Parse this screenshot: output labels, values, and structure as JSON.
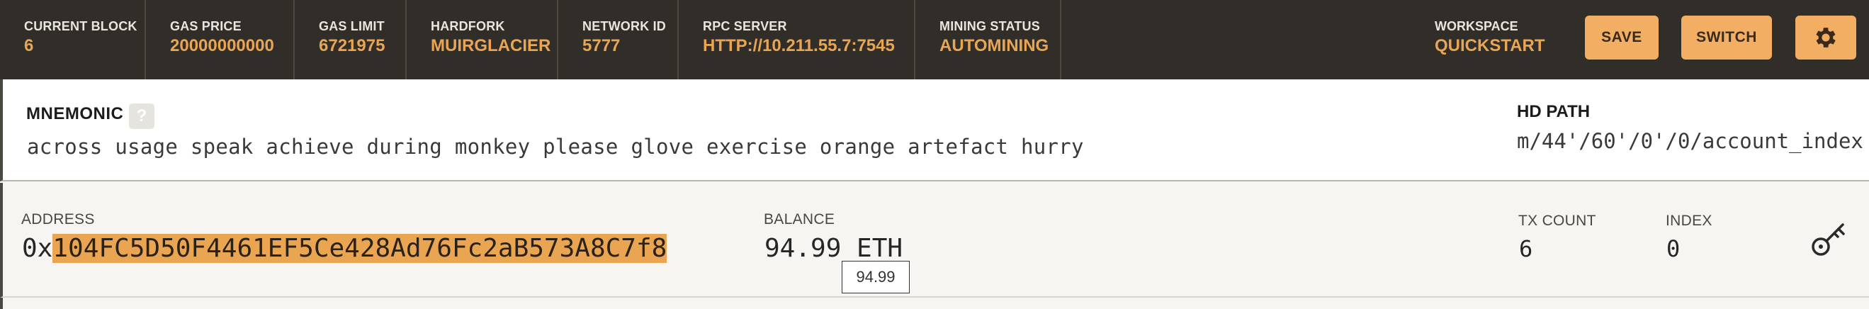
{
  "topbar": {
    "stats": [
      {
        "label": "CURRENT BLOCK",
        "value": "6"
      },
      {
        "label": "GAS PRICE",
        "value": "20000000000"
      },
      {
        "label": "GAS LIMIT",
        "value": "6721975"
      },
      {
        "label": "HARDFORK",
        "value": "MUIRGLACIER"
      },
      {
        "label": "NETWORK ID",
        "value": "5777"
      },
      {
        "label": "RPC SERVER",
        "value": "HTTP://10.211.55.7:7545"
      },
      {
        "label": "MINING STATUS",
        "value": "AUTOMINING"
      }
    ],
    "workspace": {
      "label": "WORKSPACE",
      "value": "QUICKSTART"
    },
    "save_label": "SAVE",
    "switch_label": "SWITCH",
    "settings_icon": "gear-icon"
  },
  "mnemonic": {
    "label": "MNEMONIC",
    "help_glyph": "?",
    "words": "across usage speak achieve during monkey please glove exercise orange artefact hurry",
    "hd_path_label": "HD PATH",
    "hd_path_value": "m/44'/60'/0'/0/account_index"
  },
  "account": {
    "address_label": "ADDRESS",
    "address_prefix": "0x",
    "address_highlighted": "104FC5D50F4461EF5Ce428Ad76Fc2aB573A8C7f8",
    "balance_label": "BALANCE",
    "balance_value": "94.99 ETH",
    "balance_tooltip": "94.99",
    "tx_count_label": "TX COUNT",
    "tx_count_value": "6",
    "index_label": "INDEX",
    "index_value": "0",
    "key_icon": "key-icon"
  },
  "colors": {
    "topbar_bg": "#312e2a",
    "accent": "#eaa553",
    "button_bg": "#f2ae62"
  }
}
